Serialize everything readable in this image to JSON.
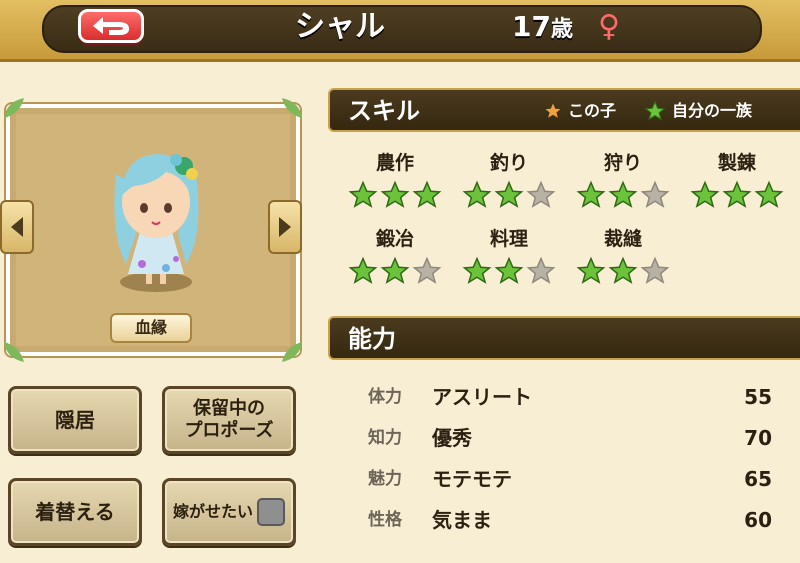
{
  "header": {
    "title": "シャル",
    "age": "17",
    "age_unit": "歳",
    "gender_symbol": "♀"
  },
  "portrait": {
    "kin_button": "血縁"
  },
  "actions": {
    "retire": "隠居",
    "pending_proposal_line1": "保留中の",
    "pending_proposal_line2": "プロポーズ",
    "change_clothes": "着替える",
    "want_marry": "嫁がせたい"
  },
  "skills_section": {
    "title": "スキル",
    "legend_this_child": "この子",
    "legend_family": "自分の一族",
    "skills": [
      {
        "name": "農作",
        "stars": 3
      },
      {
        "name": "釣り",
        "stars": 2
      },
      {
        "name": "狩り",
        "stars": 2
      },
      {
        "name": "製錬",
        "stars": 3
      },
      {
        "name": "鍛冶",
        "stars": 2
      },
      {
        "name": "料理",
        "stars": 2
      },
      {
        "name": "裁縫",
        "stars": 2
      }
    ],
    "max_stars": 3
  },
  "ability_section": {
    "title": "能力",
    "rows": [
      {
        "label": "体力",
        "value": "アスリート",
        "number": "55"
      },
      {
        "label": "知力",
        "value": "優秀",
        "number": "70"
      },
      {
        "label": "魅力",
        "value": "モテモテ",
        "number": "65"
      },
      {
        "label": "性格",
        "value": "気まま",
        "number": "60"
      }
    ]
  },
  "colors": {
    "star_green": "#6cc23a",
    "star_gray": "#b8b2a4",
    "star_orange": "#f2a23a"
  }
}
